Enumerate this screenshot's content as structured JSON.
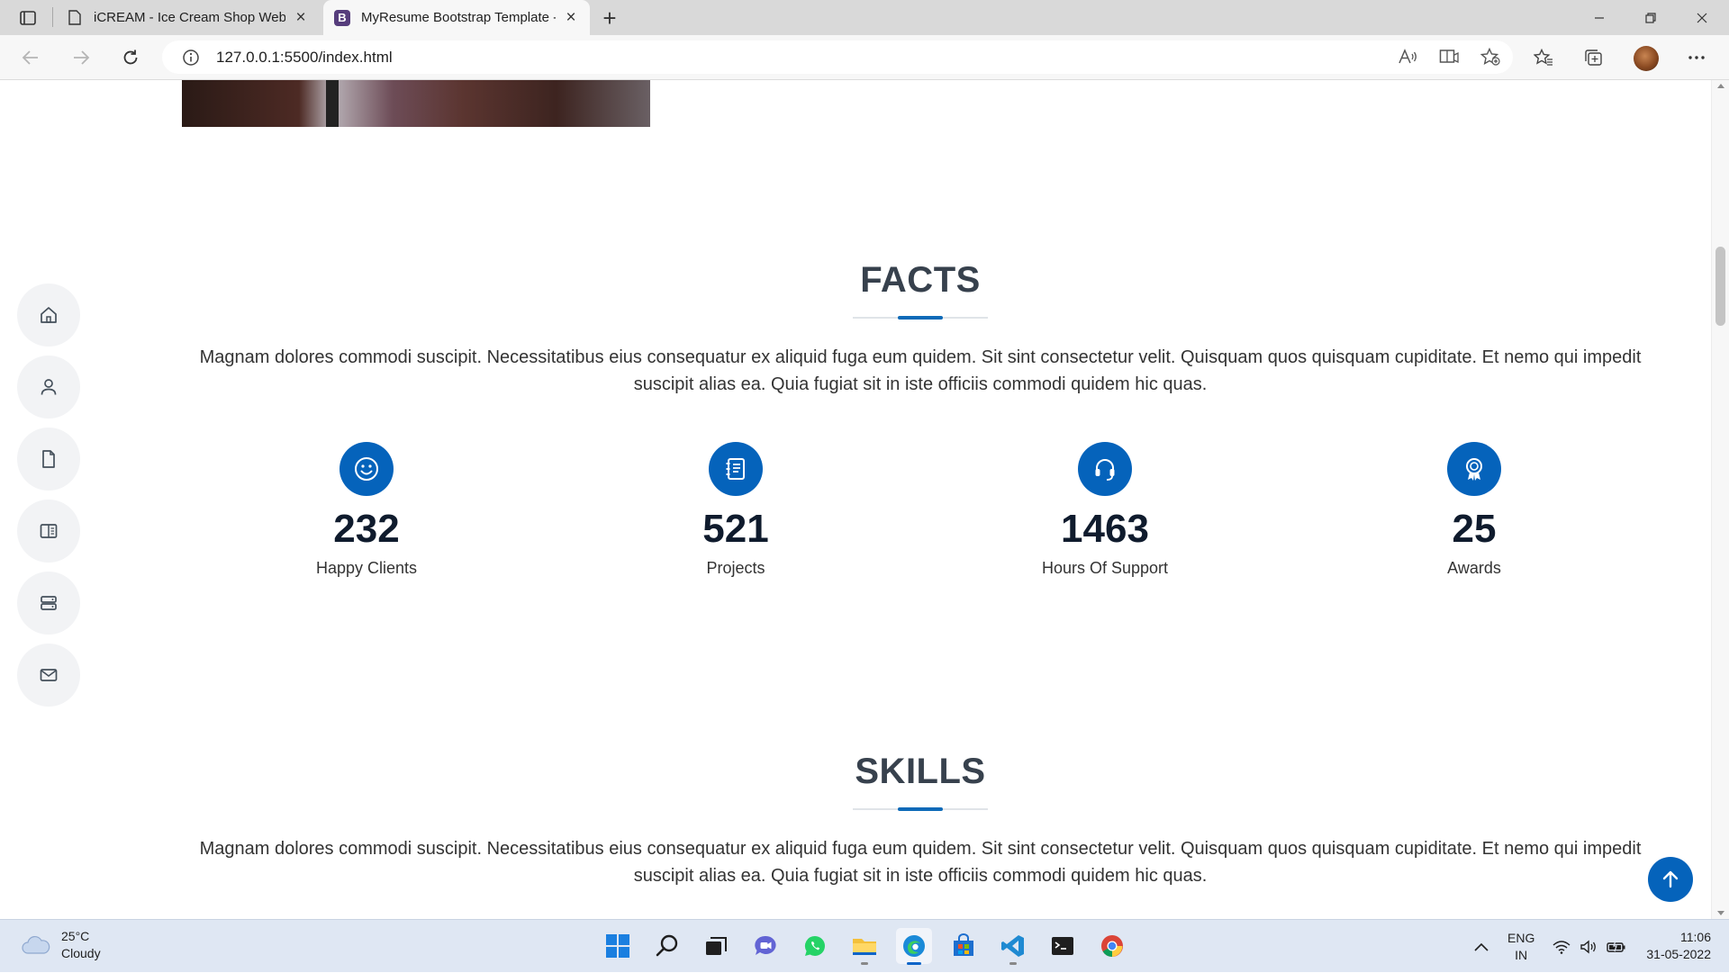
{
  "browser": {
    "tabs": [
      {
        "title": "iCREAM - Ice Cream Shop Website",
        "active": false
      },
      {
        "title": "MyResume Bootstrap Template - Index",
        "active": true,
        "favicon_letter": "B"
      }
    ],
    "url": "127.0.0.1:5500/index.html",
    "new_tab_glyph": "+",
    "close_glyph": "×"
  },
  "facts": {
    "title": "FACTS",
    "description": "Magnam dolores commodi suscipit. Necessitatibus eius consequatur ex aliquid fuga eum quidem. Sit sint consectetur velit. Quisquam quos quisquam cupiditate. Et nemo qui impedit suscipit alias ea. Quia fugiat sit in iste officiis commodi quidem hic quas.",
    "items": [
      {
        "value": "232",
        "label": "Happy Clients",
        "icon": "smiley-icon"
      },
      {
        "value": "521",
        "label": "Projects",
        "icon": "journal-list-icon"
      },
      {
        "value": "1463",
        "label": "Hours Of Support",
        "icon": "headset-icon"
      },
      {
        "value": "25",
        "label": "Awards",
        "icon": "award-icon"
      }
    ]
  },
  "skills": {
    "title": "SKILLS",
    "description": "Magnam dolores commodi suscipit. Necessitatibus eius consequatur ex aliquid fuga eum quidem. Sit sint consectetur velit. Quisquam quos quisquam cupiditate. Et nemo qui impedit suscipit alias ea. Quia fugiat sit in iste officiis commodi quidem hic quas."
  },
  "side_nav": [
    "home-icon",
    "person-icon",
    "file-icon",
    "book-icon",
    "server-icon",
    "envelope-icon"
  ],
  "taskbar": {
    "weather": {
      "temp": "25°C",
      "condition": "Cloudy"
    },
    "language": {
      "line1": "ENG",
      "line2": "IN"
    },
    "clock": {
      "time": "11:06",
      "date": "31-05-2022"
    }
  },
  "colors": {
    "accent": "#0563bb",
    "heading": "#37414d",
    "number": "#0f1b2d"
  }
}
